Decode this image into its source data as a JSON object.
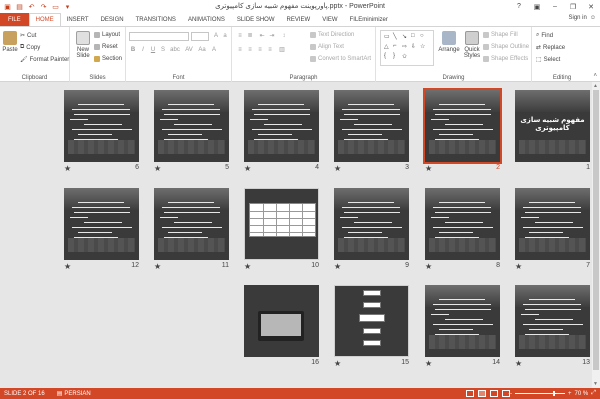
{
  "window": {
    "title": "پاورپوینت مفهوم شبیه سازی کامپیوتری.pptx - PowerPoint",
    "help": "?",
    "minimize": "–",
    "restore": "❐",
    "close": "✕"
  },
  "tabs": [
    "FILE",
    "HOME",
    "INSERT",
    "DESIGN",
    "TRANSITIONS",
    "ANIMATIONS",
    "SLIDE SHOW",
    "REVIEW",
    "VIEW",
    "FILEminimizer"
  ],
  "active_tab": "HOME",
  "signin": "Sign in",
  "ribbon": {
    "clipboard": {
      "name": "Clipboard",
      "paste": "Paste",
      "cut": "Cut",
      "copy": "Copy",
      "format_painter": "Format Painter"
    },
    "slides": {
      "name": "Slides",
      "new_slide": "New Slide",
      "layout": "Layout",
      "reset": "Reset",
      "section": "Section"
    },
    "font": {
      "name": "Font",
      "bold": "B",
      "italic": "I",
      "underline": "U",
      "strike": "S",
      "shadow": "abc",
      "spacing": "AV",
      "case": "Aa",
      "color": "A"
    },
    "paragraph": {
      "name": "Paragraph",
      "text_direction": "Text Direction",
      "align_text": "Align Text",
      "convert_smartart": "Convert to SmartArt"
    },
    "drawing": {
      "name": "Drawing",
      "arrange": "Arrange",
      "quick_styles": "Quick Styles",
      "shape_fill": "Shape Fill",
      "shape_outline": "Shape Outline",
      "shape_effects": "Shape Effects"
    },
    "editing": {
      "name": "Editing",
      "find": "Find",
      "replace": "Replace",
      "select": "Select"
    }
  },
  "slides": [
    {
      "num": "1",
      "star": false,
      "kind": "title",
      "title": "مفهوم شبیه سازی کامپیوتری"
    },
    {
      "num": "2",
      "star": true,
      "kind": "text",
      "selected": true
    },
    {
      "num": "3",
      "star": true,
      "kind": "text"
    },
    {
      "num": "4",
      "star": true,
      "kind": "text"
    },
    {
      "num": "5",
      "star": true,
      "kind": "text"
    },
    {
      "num": "6",
      "star": true,
      "kind": "text"
    },
    {
      "num": "7",
      "star": true,
      "kind": "text"
    },
    {
      "num": "8",
      "star": true,
      "kind": "text"
    },
    {
      "num": "9",
      "star": true,
      "kind": "text"
    },
    {
      "num": "10",
      "star": true,
      "kind": "table"
    },
    {
      "num": "11",
      "star": true,
      "kind": "text"
    },
    {
      "num": "12",
      "star": true,
      "kind": "text"
    },
    {
      "num": "13",
      "star": true,
      "kind": "text"
    },
    {
      "num": "14",
      "star": true,
      "kind": "text"
    },
    {
      "num": "15",
      "star": true,
      "kind": "flow"
    },
    {
      "num": "16",
      "star": false,
      "kind": "photo"
    }
  ],
  "status": {
    "slide_of": "SLIDE 2 OF 16",
    "language": "PERSIAN",
    "zoom": "70 %"
  }
}
